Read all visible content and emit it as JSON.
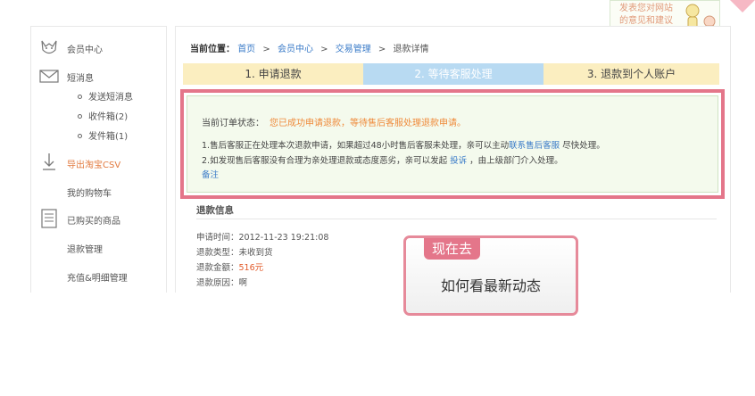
{
  "feedback": {
    "line1": "发表您对网站",
    "line2": "的意见和建议"
  },
  "sidebar": {
    "member_center": "会员中心",
    "messages": "短消息",
    "sub": [
      {
        "label": "发送短消息"
      },
      {
        "label": "收件箱(2)"
      },
      {
        "label": "发件箱(1)"
      }
    ],
    "export_csv": "导出淘宝CSV",
    "cart": "我的购物车",
    "purchased": "已购买的商品",
    "refund_mgmt": "退款管理",
    "recharge": "充值&明细管理"
  },
  "breadcrumb": {
    "label": "当前位置：",
    "items": [
      "首页",
      "会员中心",
      "交易管理"
    ],
    "current": "退款详情",
    "separator": ">"
  },
  "steps": [
    {
      "label": "1. 申请退款"
    },
    {
      "label": "2. 等待客服处理"
    },
    {
      "label": "3. 退款到个人账户"
    }
  ],
  "notice": {
    "status_label": "当前订单状态：",
    "status_text": "您已成功申请退款，等待售后客服处理退款申请。",
    "line1_pre": "1.售后客服正在处理本次退款申请，如果超过48小时售后客服未处理，亲可以主动",
    "line1_link": "联系售后客服",
    "line1_post": "尽快处理。",
    "line2_pre": "2.如发现售后客服没有合理为亲处理退款或态度恶劣，亲可以发起",
    "line2_link": "投诉",
    "line2_post": "，由上级部门介入处理。",
    "note": "备注"
  },
  "refund_info": {
    "title": "退款信息",
    "time_label": "申请时间：",
    "time_value": "2012-11-23 19:21:08",
    "type_label": "退款类型：",
    "type_value": "未收到货",
    "amount_label": "退款金额：",
    "amount_value": "516元",
    "reason_label": "退款原因：",
    "reason_value": "啊"
  },
  "popup": {
    "tag": "现在去",
    "text": "如何看最新动态"
  },
  "colors": {
    "accent_pink": "#e4768a",
    "link_blue": "#3a7bc8",
    "status_orange": "#ef8a3a",
    "step_active": "#b8daf2",
    "step_idle": "#fbeec0"
  }
}
